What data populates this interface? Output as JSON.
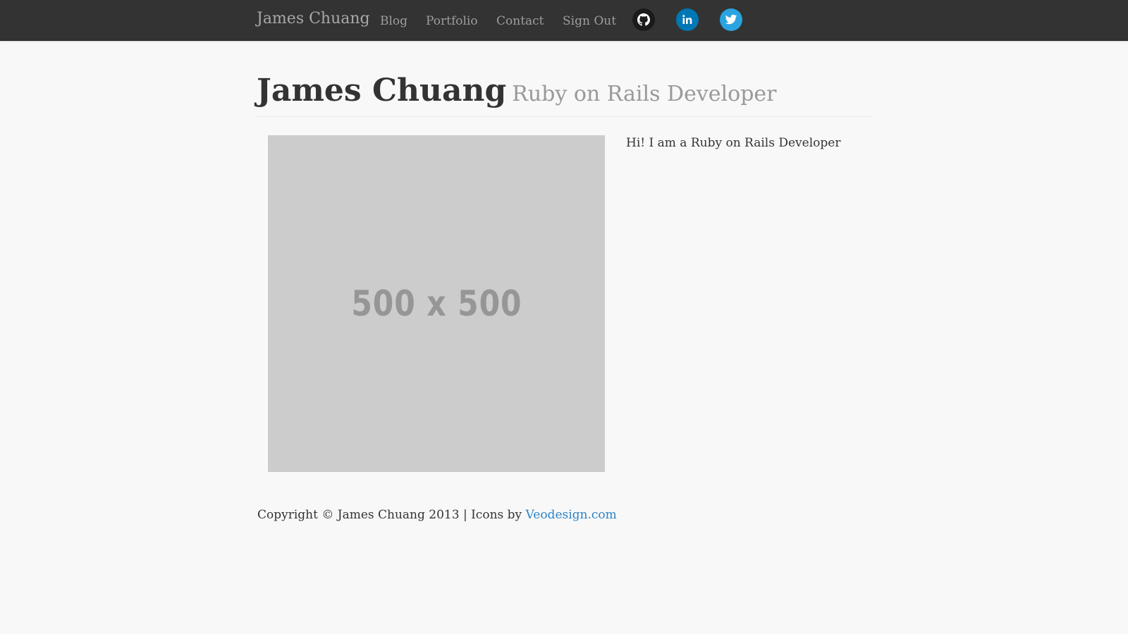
{
  "navbar": {
    "brand": "James Chuang",
    "links": [
      {
        "label": "Blog"
      },
      {
        "label": "Portfolio"
      },
      {
        "label": "Contact"
      },
      {
        "label": "Sign Out"
      }
    ],
    "social": [
      {
        "icon": "github-icon",
        "color": "#1a1a1a"
      },
      {
        "icon": "linkedin-icon",
        "color": "#0077b5"
      },
      {
        "icon": "twitter-icon",
        "color": "#2aa3e0"
      }
    ]
  },
  "header": {
    "name": "James Chuang",
    "subtitle": "Ruby on Rails Developer"
  },
  "main": {
    "image_placeholder_text": "500 x 500",
    "intro": "Hi! I am a Ruby on Rails Developer"
  },
  "footer": {
    "copyright": "Copyright © James Chuang 2013 | Icons by",
    "link_label": "Veodesign.com"
  },
  "colors": {
    "navbar_bg": "#333333",
    "page_bg": "#f8f8f8",
    "link": "#2d83c6",
    "placeholder_bg": "#cccccc"
  }
}
